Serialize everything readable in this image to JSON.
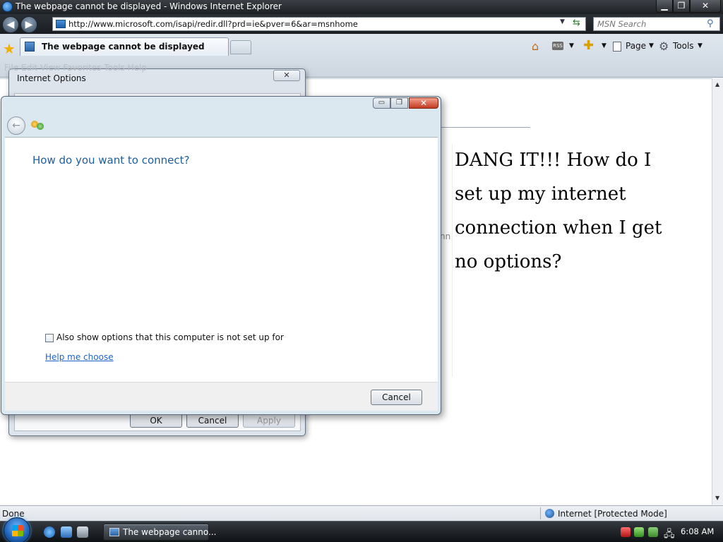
{
  "ie": {
    "window_title": "The webpage cannot be displayed - Windows Internet Explorer",
    "address": "http://www.microsoft.com/isapi/redir.dll?prd=ie&pver=6&ar=msnhome",
    "search_placeholder": "MSN Search",
    "tab_label": "The webpage cannot be displayed",
    "page_menu": "Page",
    "tools_menu": "Tools",
    "status_text": "Done",
    "zone_text": "Internet [Protected Mode]",
    "menu_ghost": "File   Edit   View   Favorites   Tools   Help"
  },
  "internet_options": {
    "title": "Internet Options",
    "ok_label": "OK",
    "cancel_label": "Cancel",
    "apply_label": "Apply"
  },
  "wizard": {
    "heading": "How do you want to connect?",
    "checkbox_label": "Also show options that this computer is not set up for",
    "help_link": "Help me choose",
    "cancel_label": "Cancel"
  },
  "overlay": {
    "text": "DANG IT!!! How do I set up my internet connection when I get no options?"
  },
  "taskbar": {
    "task_label": "The webpage canno...",
    "clock": "6:08 AM"
  },
  "icons": [
    "ie-icon",
    "back-icon",
    "forward-icon",
    "refresh-icon",
    "search-icon",
    "favorites-star-icon",
    "home-icon",
    "rss-icon",
    "print-icon",
    "page-icon",
    "tools-gear-icon",
    "globe-icon",
    "start-orb-icon",
    "network-icon"
  ],
  "colors": {
    "heading_blue": "#1f5e9a",
    "link_blue": "#1e64c8",
    "close_red": "#c23a1f"
  }
}
